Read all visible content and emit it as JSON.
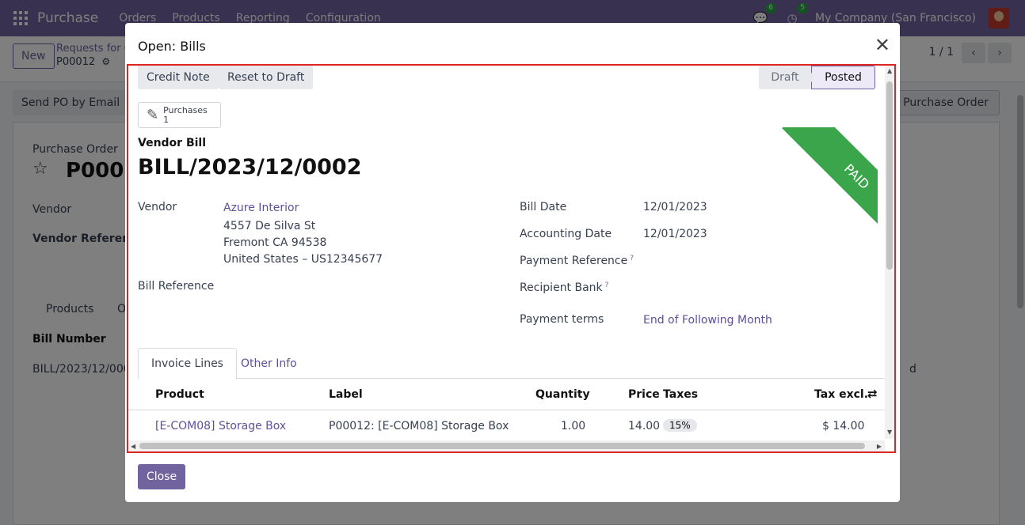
{
  "navbar": {
    "app_name": "Purchase",
    "menus": [
      "Orders",
      "Products",
      "Reporting",
      "Configuration"
    ],
    "chat_count": "6",
    "activity_count": "5",
    "company": "My Company (San Francisco)"
  },
  "control_panel": {
    "new_label": "New",
    "breadcrumb_parent": "Requests for Q",
    "breadcrumb_current": "P00012",
    "pager": "1 / 1"
  },
  "background": {
    "send_po_label": "Send PO by Email",
    "purchase_order_button": "Purchase Order",
    "record_type": "Purchase Order",
    "record_name": "P0001",
    "vendor_label": "Vendor",
    "vendor_reference_label": "Vendor Reference",
    "tab_products": "Products",
    "tab_other": "O",
    "col_bill_number": "Bill Number",
    "row_bill": "BILL/2023/12/000",
    "row_status_partial": "d"
  },
  "modal": {
    "title": "Open: Bills",
    "close_label": "Close",
    "buttons": {
      "credit_note": "Credit Note",
      "reset_to_draft": "Reset to Draft"
    },
    "status": {
      "draft": "Draft",
      "posted": "Posted"
    },
    "smart_button": {
      "label": "Purchases",
      "count": "1"
    },
    "doc_type": "Vendor Bill",
    "doc_name": "BILL/2023/12/0002",
    "ribbon": "PAID",
    "vendor": {
      "label": "Vendor",
      "name": "Azure Interior",
      "address_line1": "4557 De Silva St",
      "address_line2": "Fremont CA 94538",
      "address_line3": "United States – US12345677"
    },
    "bill_reference_label": "Bill Reference",
    "bill_date": {
      "label": "Bill Date",
      "value": "12/01/2023"
    },
    "accounting_date": {
      "label": "Accounting Date",
      "value": "12/01/2023"
    },
    "payment_reference_label": "Payment Reference",
    "recipient_bank_label": "Recipient Bank",
    "payment_terms": {
      "label": "Payment terms",
      "value": "End of Following Month"
    },
    "tabs": [
      "Invoice Lines",
      "Other Info"
    ],
    "table": {
      "headers": {
        "product": "Product",
        "label": "Label",
        "quantity": "Quantity",
        "price": "Price",
        "taxes": "Taxes",
        "tax_excl": "Tax excl."
      },
      "rows": [
        {
          "product": "[E-COM08] Storage Box",
          "label": "P00012: [E-COM08] Storage Box",
          "quantity": "1.00",
          "price": "14.00",
          "tax": "15%",
          "tax_excl": "$ 14.00"
        }
      ]
    }
  }
}
